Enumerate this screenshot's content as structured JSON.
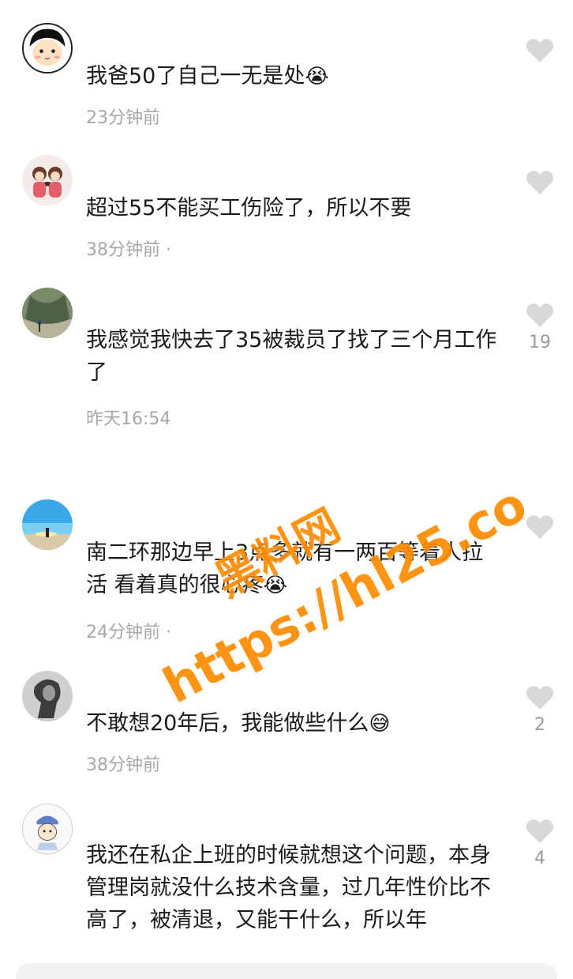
{
  "comments": [
    {
      "text": "我爸50了自己一无是处",
      "emoji": "😭",
      "time": "23分钟前",
      "likes": "",
      "avatar_icon": "cartoon-face"
    },
    {
      "text": "超过55不能买工伤险了，所以不要",
      "emoji": "",
      "time": "38分钟前 ·",
      "likes": "",
      "avatar_icon": "family-photo"
    },
    {
      "text": "我感觉我快去了35被裁员了找了三个月工作了",
      "emoji": "",
      "time": "昨天16:54",
      "likes": "19",
      "avatar_icon": "peacock-photo"
    },
    {
      "text": "南二环那边早上3点多就有一两百等着人拉活 看着真的很心疼",
      "emoji": "😭",
      "time": "24分钟前 ·",
      "likes": "",
      "avatar_icon": "beach-photo"
    },
    {
      "text": "不敢想20年后，我能做些什么",
      "emoji": "😅",
      "time": "38分钟前",
      "likes": "2",
      "avatar_icon": "sketch-portrait"
    },
    {
      "text": "我还在私企上班的时候就想这个问题，本身管理岗就没什么技术含量，过几年性价比不高了，被清退，又能干什么，所以年",
      "emoji": "",
      "time": "",
      "likes": "4",
      "avatar_icon": "cartoon-cap"
    }
  ],
  "watermark": {
    "cn": "黑料网",
    "url": "https://hl25.co"
  },
  "colors": {
    "text": "#1a1a1a",
    "time": "#a7a7a7",
    "heart": "#d8d8d8",
    "watermark": "#ff8a00"
  }
}
